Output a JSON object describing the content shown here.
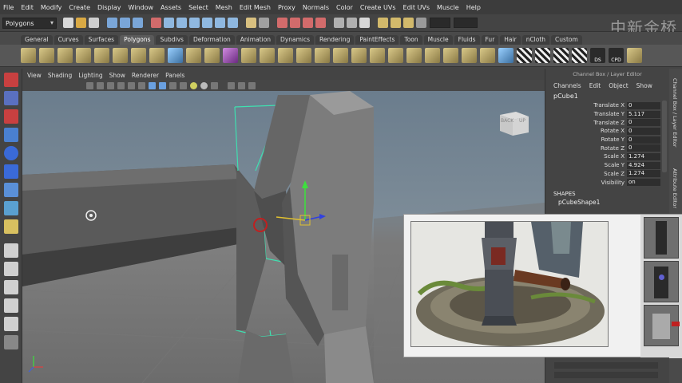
{
  "menubar": {
    "items": [
      "File",
      "Edit",
      "Modify",
      "Create",
      "Display",
      "Window",
      "Assets",
      "Select",
      "Mesh",
      "Edit Mesh",
      "Proxy",
      "Normals",
      "Color",
      "Create UVs",
      "Edit UVs",
      "Muscle",
      "Help"
    ]
  },
  "statusline": {
    "mode": "Polygons",
    "watermark": "中新金桥"
  },
  "shelf": {
    "tabs": [
      "General",
      "Curves",
      "Surfaces",
      "Polygons",
      "Subdivs",
      "Deformation",
      "Animation",
      "Dynamics",
      "Rendering",
      "PaintEffects",
      "Toon",
      "Muscle",
      "Fluids",
      "Fur",
      "Hair",
      "nCloth",
      "Custom"
    ],
    "active_tab": "Polygons",
    "ds_label": "DS",
    "cpd_label": "CPD"
  },
  "panel": {
    "menus": [
      "View",
      "Shading",
      "Lighting",
      "Show",
      "Renderer",
      "Panels"
    ]
  },
  "viewcube": {
    "face_back": "BACK",
    "face_up": "UP"
  },
  "channelbox": {
    "title": "Channel Box / Layer Editor",
    "tabs": [
      "Channels",
      "Edit",
      "Object",
      "Show"
    ],
    "node": "pCube1",
    "attributes": [
      {
        "label": "Translate X",
        "value": "0"
      },
      {
        "label": "Translate Y",
        "value": "5.117"
      },
      {
        "label": "Translate Z",
        "value": "0"
      },
      {
        "label": "Rotate X",
        "value": "0"
      },
      {
        "label": "Rotate Y",
        "value": "0"
      },
      {
        "label": "Rotate Z",
        "value": "0"
      },
      {
        "label": "Scale X",
        "value": "1.274"
      },
      {
        "label": "Scale Y",
        "value": "4.924"
      },
      {
        "label": "Scale Z",
        "value": "1.274"
      },
      {
        "label": "Visibility",
        "value": "on"
      }
    ],
    "shapes_header": "SHAPES",
    "shape_node": "pCubeShape1"
  },
  "sidetabs": {
    "channel_box": "Channel Box / Layer Editor",
    "attribute_editor": "Attribute Editor"
  },
  "colors": {
    "wireframe_highlight": "#3fe0b0",
    "manipulator_y": "#3ce13c",
    "manipulator_x": "#e0c030",
    "manipulator_z": "#3040e0",
    "sky_top": "#6b7d8d",
    "ground": "#7f7f7f"
  }
}
